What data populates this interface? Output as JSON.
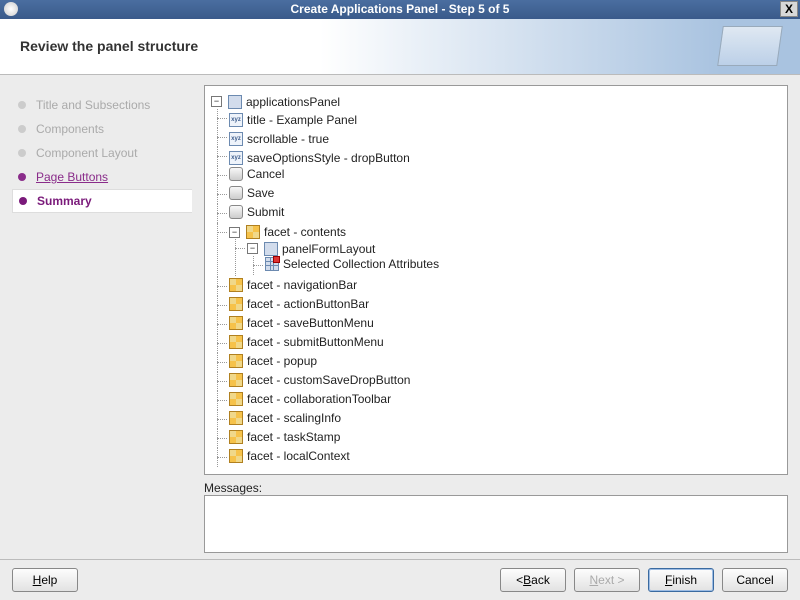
{
  "window": {
    "title": "Create Applications Panel - Step 5 of 5",
    "close_glyph": "X"
  },
  "header": {
    "title": "Review the panel structure"
  },
  "steps": [
    {
      "label": "Title and Subsections",
      "state": "disabled"
    },
    {
      "label": "Components",
      "state": "disabled"
    },
    {
      "label": "Component Layout",
      "state": "disabled"
    },
    {
      "label": "Page Buttons",
      "state": "link"
    },
    {
      "label": "Summary",
      "state": "current"
    }
  ],
  "tree": {
    "root": "applicationsPanel",
    "attrs": [
      "title - Example Panel",
      "scrollable - true",
      "saveOptionsStyle - dropButton"
    ],
    "buttons": [
      "Cancel",
      "Save",
      "Submit"
    ],
    "contents_label": "facet - contents",
    "panelform_label": "panelFormLayout",
    "collection_label": "Selected Collection Attributes",
    "facets": [
      "facet - navigationBar",
      "facet - actionButtonBar",
      "facet - saveButtonMenu",
      "facet - submitButtonMenu",
      "facet - popup",
      "facet - customSaveDropButton",
      "facet - collaborationToolbar",
      "facet - scalingInfo",
      "facet - taskStamp",
      "facet - localContext"
    ]
  },
  "messages": {
    "label": "Messages:"
  },
  "footer": {
    "help": "Help",
    "back": "< Back",
    "next": "Next >",
    "finish": "Finish",
    "cancel": "Cancel"
  }
}
